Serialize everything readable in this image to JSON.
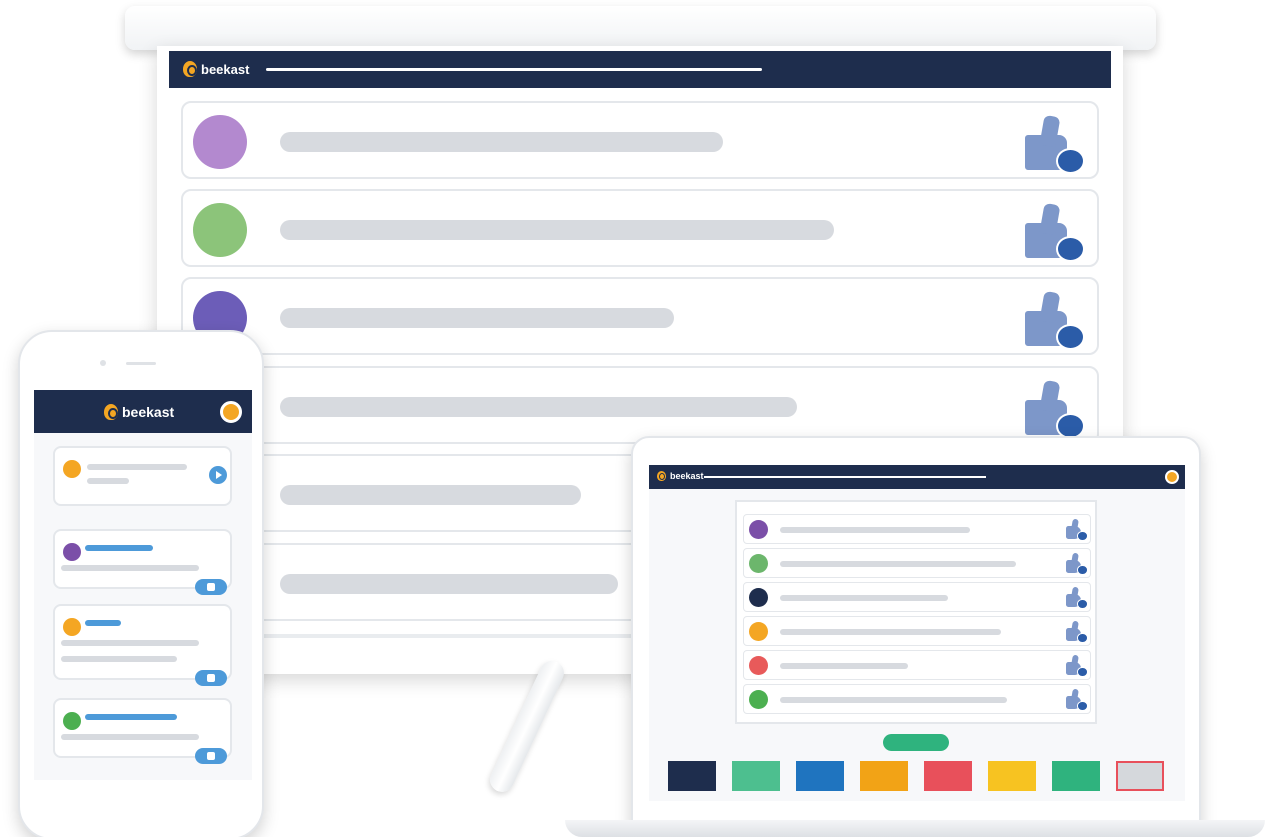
{
  "app": {
    "brand": "beekast"
  },
  "screen": {
    "rows": [
      {
        "avatar_color": "#b389cf",
        "avatar": "purple-character-avatar",
        "line_pct": 0.72,
        "visible": true
      },
      {
        "avatar_color": "#8cc47a",
        "avatar": "green-character-avatar",
        "line_pct": 0.9,
        "visible": true
      },
      {
        "avatar_color": "#6c5db8",
        "avatar": "indigo-character-avatar",
        "line_pct": 0.64,
        "visible": true
      },
      {
        "avatar_color": "#f4a623",
        "avatar": "orange-character-avatar",
        "line_pct": 0.84,
        "visible": true
      },
      {
        "avatar_color": "#e85a5a",
        "avatar": "red-character-avatar",
        "line_pct": 0.49,
        "visible": true
      },
      {
        "avatar_color": "#4caf50",
        "avatar": "green-character-avatar",
        "line_pct": 0.55,
        "visible": true
      }
    ],
    "like_icon": "thumbs-up-icon"
  },
  "phone": {
    "cards": [
      {
        "type": "compose",
        "avatar_color": "#f4a623",
        "action_icon": "send-icon"
      },
      {
        "type": "idea",
        "avatar_color": "#7b4fa8",
        "like_icon": "thumbs-up-icon"
      },
      {
        "type": "idea",
        "avatar_color": "#f4a623",
        "like_icon": "thumbs-up-icon"
      },
      {
        "type": "idea",
        "avatar_color": "#4caf50",
        "like_icon": "thumbs-up-icon"
      }
    ]
  },
  "laptop": {
    "rows": [
      {
        "avatar_color": "#7b4fa8"
      },
      {
        "avatar_color": "#6cb66c"
      },
      {
        "avatar_color": "#1e2d4d"
      },
      {
        "avatar_color": "#f4a623"
      },
      {
        "avatar_color": "#e85a5a"
      },
      {
        "avatar_color": "#4caf50"
      }
    ],
    "submit_color": "#2fb37e",
    "swatches": [
      "#1e2d4d",
      "#4dbf8f",
      "#1f74bf",
      "#f2a316",
      "#e8505b",
      "#f7c321",
      "#2fb37e",
      "#d5d8dc"
    ]
  }
}
